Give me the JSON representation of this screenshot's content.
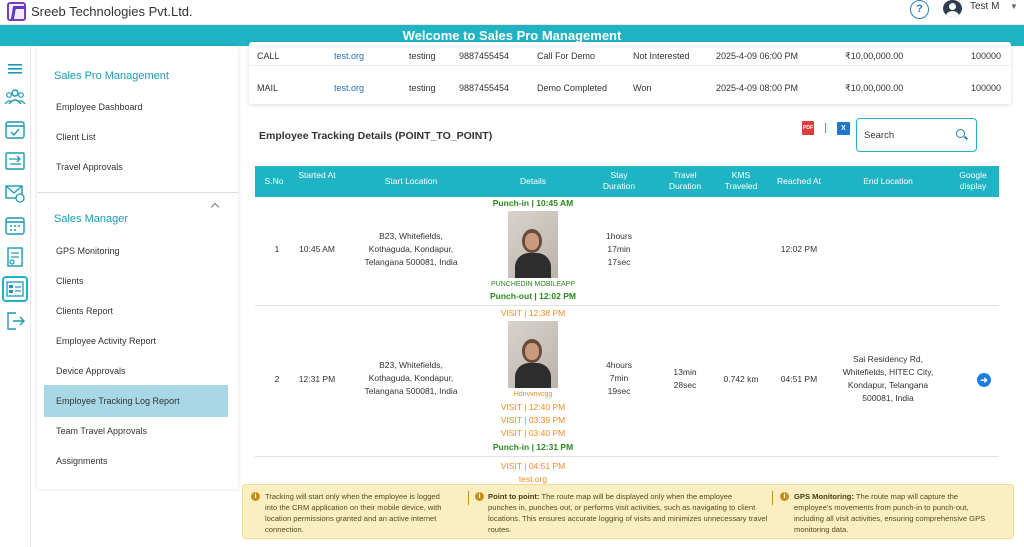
{
  "app": {
    "company": "Sreeb Technologies Pvt.Ltd.",
    "welcome": "Welcome to Sales Pro Management",
    "user_name": "Test M",
    "user_caret": "▼"
  },
  "sidebar": {
    "section1_title": "Sales Pro Management",
    "section1_items": [
      "Employee Dashboard",
      "Client List",
      "Travel Approvals"
    ],
    "section2_title": "Sales Manager",
    "section2_items": [
      "GPS Monitoring",
      "Clients",
      "Clients Report",
      "Employee Activity Report",
      "Device Approvals",
      "Employee Tracking Log Report",
      "Team Travel Approvals",
      "Assignments"
    ],
    "active_item": "Employee Tracking Log Report"
  },
  "top_table": {
    "rows": [
      [
        "CALL",
        "test.org",
        "testing",
        "9887455454",
        "Call For Demo",
        "Not Interested",
        "2025-4-09 06:00 PM",
        "₹10,00,000.00",
        "100000"
      ],
      [
        "MAIL",
        "test.org",
        "testing",
        "9887455454",
        "Demo Completed",
        "Won",
        "2025-4-09 08:00 PM",
        "₹10,00,000.00",
        "100000"
      ]
    ]
  },
  "tracking": {
    "title": "Employee Tracking Details (POINT_TO_POINT)",
    "pdf_label": "PDF",
    "xls_label": "X",
    "search_placeholder": "Search",
    "headers": [
      "S.No",
      "Started At",
      "Start Location",
      "Details",
      "Stay Duration",
      "Travel Duration",
      "KMS Traveled",
      "Reached At",
      "End Location",
      "Google display"
    ],
    "rows": [
      {
        "sno": "1",
        "started": "10:45 AM",
        "start_loc": [
          "B23, Whitefields,",
          "Kothaguda, Kondapur,",
          "Telangana 500081, India"
        ],
        "punch_in": "Punch-in | 10:45 AM",
        "photo_label": "PUNCHEDIN MOBILEAPP",
        "punch_out": "Punch-out | 12:02 PM",
        "stay": [
          "1hours",
          "17min",
          "17sec"
        ],
        "travel": [],
        "kms": "",
        "reached": "12:02 PM",
        "end_loc": []
      },
      {
        "sno": "2",
        "started": "12:31 PM",
        "start_loc": [
          "B23, Whitefields,",
          "Kothaguda, Kondapur,",
          "Telangana 500081, India"
        ],
        "visit_top": "VISIT | 12:38 PM",
        "photo_label": "Hdnvvnvcgg",
        "visits": [
          "VISIT | 12:40 PM",
          "VISIT | 03:39 PM",
          "VISIT | 03:40 PM"
        ],
        "punch_in": "Punch-in | 12:31 PM",
        "stay": [
          "4hours",
          "7min",
          "19sec"
        ],
        "travel": [
          "13min",
          "28sec"
        ],
        "kms": "0.742 km",
        "reached": "04:51 PM",
        "end_loc": [
          "Sai Residency Rd,",
          "Whitefields, HITEC City,",
          "Kondapur, Telangana",
          "500081, India"
        ]
      },
      {
        "visit": "VISIT | 04:51 PM",
        "client": "test.org"
      }
    ]
  },
  "info": {
    "col1": [
      "Tracking will start only when the employee is logged",
      "into the CRM application on their mobile device, with",
      "location permissions granted and an active internet",
      "connection."
    ],
    "col2_label": "Point to point:",
    "col2": [
      "The route map will be displayed only when the employee",
      "punches in, punches out, or performs visit activities, such as navigating to client",
      "locations. This ensures accurate logging of visits and minimizes unnecessary travel",
      "routes."
    ],
    "col3_label": "GPS Monitoring:",
    "col3": [
      "The route map will capture the",
      "employee's movements from punch-in to punch-out,",
      "including all visit activities, ensuring comprehensive GPS",
      "monitoring data."
    ]
  },
  "colors": {
    "accent": "#1fb4c3",
    "active_item": "#a8d8e6",
    "green": "#2a8a1f",
    "orange": "#f08c1a",
    "info_bg": "#fbeec0"
  },
  "icons": [
    "menu-icon",
    "team-icon",
    "calendar-check-icon",
    "transfer-icon",
    "mail-settings-icon",
    "calendar-grid-icon",
    "invoice-icon",
    "crm-icon",
    "logout-icon"
  ]
}
